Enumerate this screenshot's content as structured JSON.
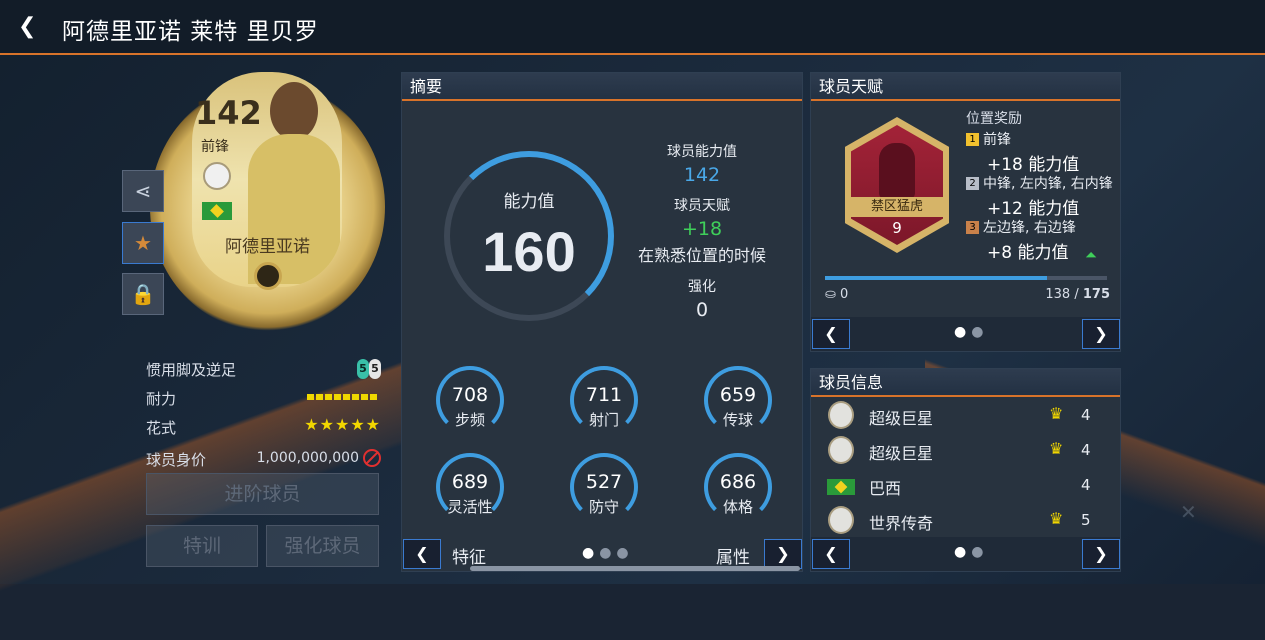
{
  "header": {
    "title": "阿德里亚诺 莱特 里贝罗"
  },
  "card": {
    "rating": "142",
    "position": "前锋",
    "name": "阿德里亚诺"
  },
  "info_rows": [
    {
      "label": "惯用脚及逆足",
      "left_foot": "5",
      "right_foot": "5"
    },
    {
      "label": "耐力",
      "stamina_fraction": 1.0
    },
    {
      "label": "花式",
      "stars": "★★★★★"
    },
    {
      "label": "球员身价",
      "value": "1,000,000,000"
    }
  ],
  "buttons": {
    "upgrade": "进阶球员",
    "training": "特训",
    "enhance": "强化球员"
  },
  "summary": {
    "title": "摘要",
    "overall_label": "能力值",
    "overall_value": "160",
    "rating_label": "球员能力值",
    "rating_value": "142",
    "talent_label": "球员天赋",
    "talent_value": "+18",
    "talent_note": "在熟悉位置的时候",
    "enhance_label": "强化",
    "enhance_value": "0",
    "stats": [
      {
        "label": "步频",
        "value": "708"
      },
      {
        "label": "射门",
        "value": "711"
      },
      {
        "label": "传球",
        "value": "659"
      },
      {
        "label": "灵活性",
        "value": "689"
      },
      {
        "label": "防守",
        "value": "527"
      },
      {
        "label": "体格",
        "value": "686"
      }
    ],
    "left_tab": "特征",
    "right_tab": "属性"
  },
  "talent": {
    "title": "球员天赋",
    "badge_name": "禁区猛虎",
    "badge_level": "9",
    "bonus_title": "位置奖励",
    "bonuses": [
      {
        "tier": "1",
        "positions": "前锋",
        "bonus": "+18 能力值"
      },
      {
        "tier": "2",
        "positions": "中锋, 左内锋, 右内锋",
        "bonus": "+12 能力值"
      },
      {
        "tier": "3",
        "positions": "左边锋, 右边锋",
        "bonus": "+8 能力值"
      }
    ],
    "items": "0",
    "progress_current": "138",
    "progress_max": "175"
  },
  "player_info": {
    "title": "球员信息",
    "rows": [
      {
        "label": "超级巨星",
        "count": "4"
      },
      {
        "label": "超级巨星",
        "count": "4"
      },
      {
        "label": "巴西",
        "count": "4"
      },
      {
        "label": "世界传奇",
        "count": "5"
      }
    ]
  },
  "colors": {
    "accent": "#d8732a",
    "blue": "#3e9de0",
    "green": "#3fcf5a",
    "gold": "#f2d700"
  }
}
